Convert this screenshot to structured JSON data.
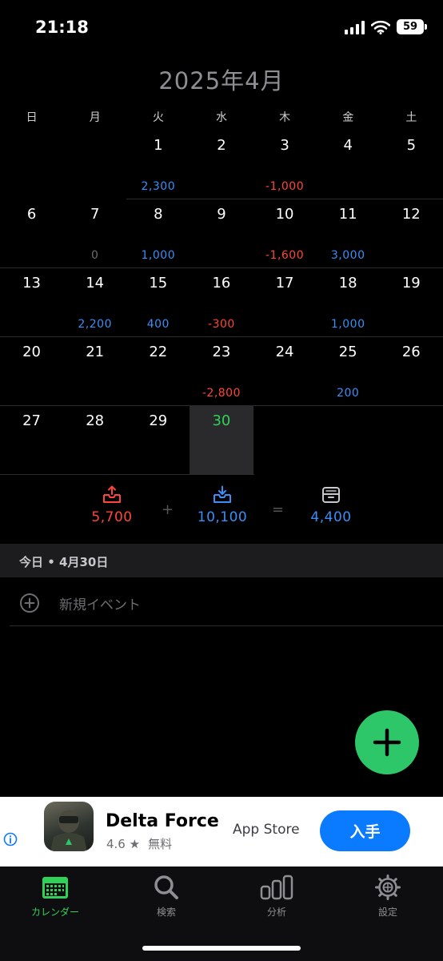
{
  "status_bar": {
    "time": "21:18",
    "battery": "59"
  },
  "calendar": {
    "title": "2025年4月",
    "weekdays": [
      "日",
      "月",
      "火",
      "水",
      "木",
      "金",
      "土"
    ],
    "today_day": "30"
  },
  "summary": {
    "expense": "5,700",
    "plus": "+",
    "income": "10,100",
    "equals": "=",
    "balance": "4,400",
    "colors": {
      "expense": "#ff453a",
      "income": "#3a8ef6",
      "balance": "#3a8ef6"
    }
  },
  "section": {
    "header": "今日 • 4月30日",
    "new_event": "新規イベント"
  },
  "ad": {
    "app_name": "Delta Force",
    "rating": "4.6 ★",
    "price": "無料",
    "store": "App Store",
    "button": "入手"
  },
  "tabs": [
    {
      "label": "カレンダー",
      "icon": "calendar-icon",
      "active": true
    },
    {
      "label": "検索",
      "icon": "search-icon",
      "active": false
    },
    {
      "label": "分析",
      "icon": "chart-icon",
      "active": false
    },
    {
      "label": "設定",
      "icon": "gear-icon",
      "active": false
    }
  ],
  "weeks": [
    {
      "days": [
        {
          "day": "",
          "amount": ""
        },
        {
          "day": "",
          "amount": ""
        },
        {
          "day": "1",
          "amount": "2,300"
        },
        {
          "day": "2",
          "amount": ""
        },
        {
          "day": "3",
          "amount": "-1,000"
        },
        {
          "day": "4",
          "amount": ""
        },
        {
          "day": "5",
          "amount": ""
        }
      ]
    },
    {
      "days": [
        {
          "day": "6",
          "amount": ""
        },
        {
          "day": "7",
          "amount": "0"
        },
        {
          "day": "8",
          "amount": "1,000"
        },
        {
          "day": "9",
          "amount": ""
        },
        {
          "day": "10",
          "amount": "-1,600"
        },
        {
          "day": "11",
          "amount": "3,000"
        },
        {
          "day": "12",
          "amount": ""
        }
      ]
    },
    {
      "days": [
        {
          "day": "13",
          "amount": ""
        },
        {
          "day": "14",
          "amount": "2,200"
        },
        {
          "day": "15",
          "amount": "400"
        },
        {
          "day": "16",
          "amount": "-300"
        },
        {
          "day": "17",
          "amount": ""
        },
        {
          "day": "18",
          "amount": "1,000"
        },
        {
          "day": "19",
          "amount": ""
        }
      ]
    },
    {
      "days": [
        {
          "day": "20",
          "amount": ""
        },
        {
          "day": "21",
          "amount": ""
        },
        {
          "day": "22",
          "amount": ""
        },
        {
          "day": "23",
          "amount": "-2,800"
        },
        {
          "day": "24",
          "amount": ""
        },
        {
          "day": "25",
          "amount": "200"
        },
        {
          "day": "26",
          "amount": ""
        }
      ]
    },
    {
      "days": [
        {
          "day": "27",
          "amount": ""
        },
        {
          "day": "28",
          "amount": ""
        },
        {
          "day": "29",
          "amount": ""
        },
        {
          "day": "30",
          "amount": ""
        }
      ]
    }
  ]
}
